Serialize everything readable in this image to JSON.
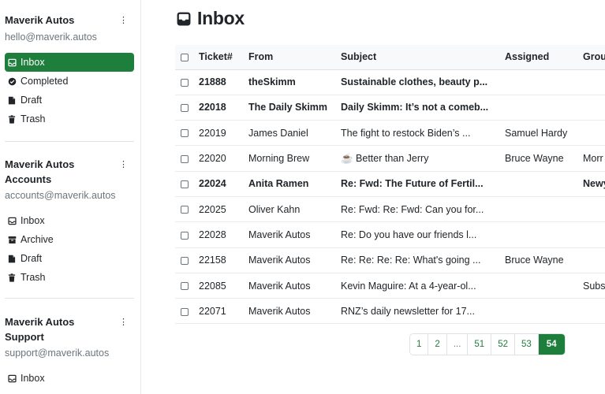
{
  "sidebar": {
    "accounts": [
      {
        "name_lines": [
          "Maverik Autos"
        ],
        "email": "hello@maverik.autos",
        "menu_icon": "kebab-icon",
        "items": [
          {
            "label": "Inbox",
            "icon": "inbox-icon",
            "active": true
          },
          {
            "label": "Completed",
            "icon": "check-circle-icon",
            "active": false
          },
          {
            "label": "Draft",
            "icon": "file-icon",
            "active": false
          },
          {
            "label": "Trash",
            "icon": "trash-icon",
            "active": false
          }
        ]
      },
      {
        "name_lines": [
          "Maverik Autos",
          "Accounts"
        ],
        "email": "accounts@maverik.autos",
        "menu_icon": "kebab-icon",
        "items": [
          {
            "label": "Inbox",
            "icon": "inbox-icon",
            "active": false
          },
          {
            "label": "Archive",
            "icon": "archive-icon",
            "active": false
          },
          {
            "label": "Draft",
            "icon": "file-icon",
            "active": false
          },
          {
            "label": "Trash",
            "icon": "trash-icon",
            "active": false
          }
        ]
      },
      {
        "name_lines": [
          "Maverik Autos",
          "Support"
        ],
        "email": "support@maverik.autos",
        "menu_icon": "kebab-icon",
        "items": [
          {
            "label": "Inbox",
            "icon": "inbox-icon",
            "active": false
          }
        ]
      }
    ]
  },
  "main": {
    "title": "Inbox",
    "title_icon": "inbox-icon",
    "columns": [
      "Ticket#",
      "From",
      "Subject",
      "Assigned",
      "Grou"
    ],
    "rows": [
      {
        "unread": true,
        "ticket": "21888",
        "from": "theSkimm",
        "subject": "Sustainable clothes, beauty p...",
        "assigned": "",
        "group": ""
      },
      {
        "unread": true,
        "ticket": "22018",
        "from": "The Daily Skimm",
        "subject": "Daily Skimm: It’s not a comeb...",
        "assigned": "",
        "group": ""
      },
      {
        "unread": false,
        "ticket": "22019",
        "from": "James Daniel",
        "subject": "The fight to restock Biden’s ...",
        "assigned": "Samuel Hardy",
        "group": ""
      },
      {
        "unread": false,
        "ticket": "22020",
        "from": "Morning Brew",
        "subject": "☕ Better than Jerry",
        "assigned": "Bruce Wayne",
        "group": "Morr"
      },
      {
        "unread": true,
        "ticket": "22024",
        "from": "Anita Ramen",
        "subject": "Re: Fwd: The Future of Fertil...",
        "assigned": "",
        "group": "Newy"
      },
      {
        "unread": false,
        "ticket": "22025",
        "from": "Oliver Kahn",
        "subject": "Re: Fwd: Re: Fwd: Can you for...",
        "assigned": "",
        "group": ""
      },
      {
        "unread": false,
        "ticket": "22028",
        "from": "Maverik Autos",
        "subject": "Re: Do you have our friends l...",
        "assigned": "",
        "group": ""
      },
      {
        "unread": false,
        "ticket": "22158",
        "from": "Maverik Autos",
        "subject": "Re: Re: Re: Re: What's going ...",
        "assigned": "Bruce Wayne",
        "group": ""
      },
      {
        "unread": false,
        "ticket": "22085",
        "from": "Maverik Autos",
        "subject": "Kevin Maguire: At a 4-year-ol...",
        "assigned": "",
        "group": "Subs"
      },
      {
        "unread": false,
        "ticket": "22071",
        "from": "Maverik Autos",
        "subject": "RNZ’s daily newsletter for 17...",
        "assigned": "",
        "group": ""
      }
    ],
    "pagination": {
      "pages": [
        "1",
        "2",
        "...",
        "51",
        "52",
        "53",
        "54"
      ],
      "current": "54"
    }
  },
  "colors": {
    "accent": "#1e7e3b",
    "muted_text": "#6c757d",
    "header_bg": "#f8f9fa"
  }
}
